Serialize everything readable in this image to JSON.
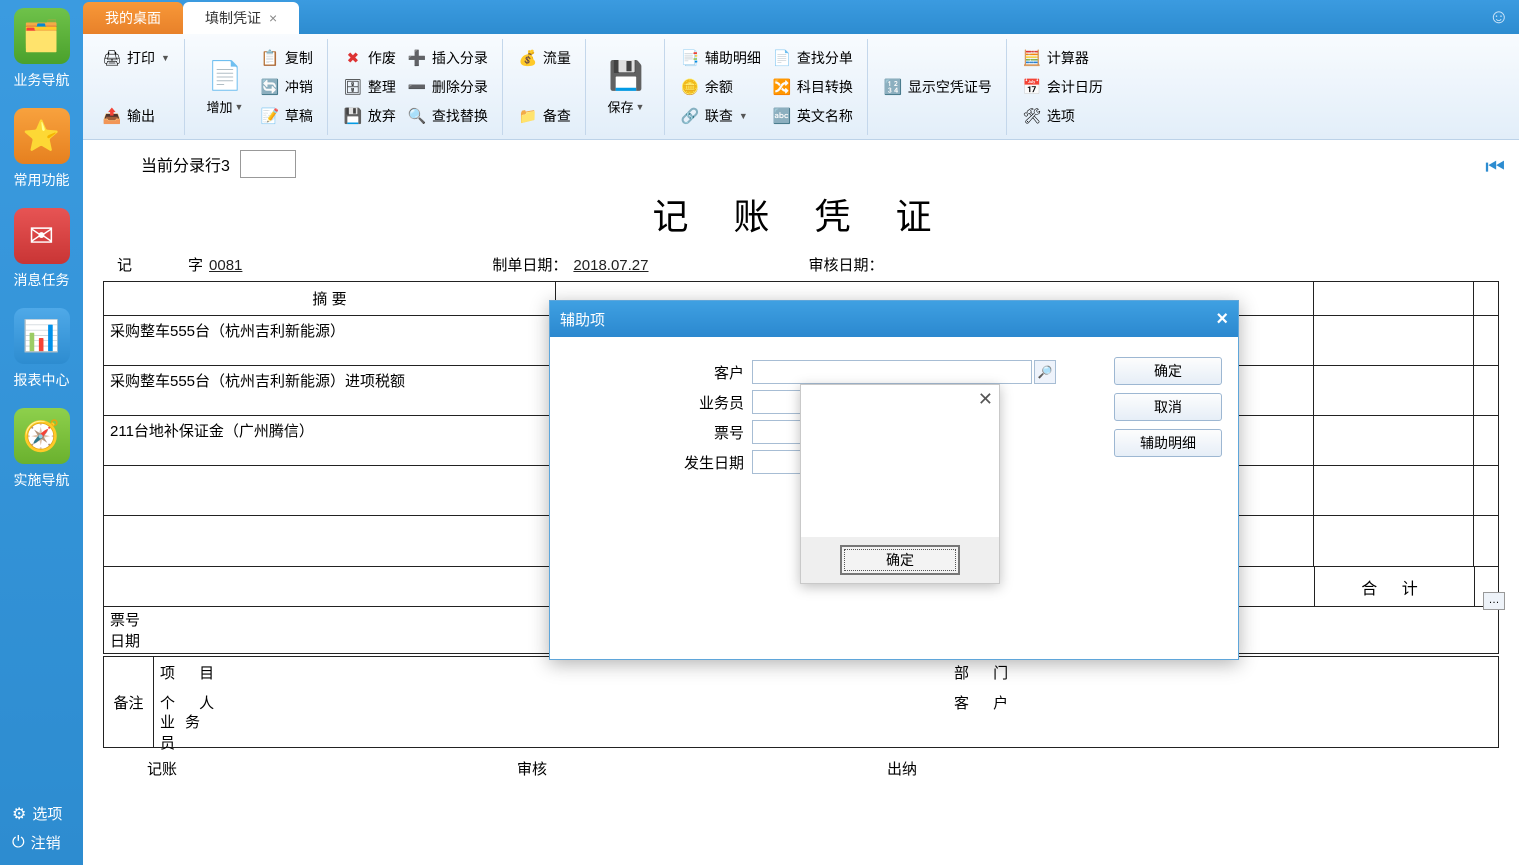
{
  "sidebar": {
    "items": [
      {
        "label": "业务导航"
      },
      {
        "label": "常用功能"
      },
      {
        "label": "消息任务"
      },
      {
        "label": "报表中心"
      },
      {
        "label": "实施导航"
      }
    ],
    "bottom": [
      {
        "label": "选项"
      },
      {
        "label": "注销"
      }
    ]
  },
  "tabs": {
    "desktop": "我的桌面",
    "voucher": "填制凭证"
  },
  "ribbon": {
    "print": "打印",
    "export": "输出",
    "add": "增加",
    "copy": "复制",
    "hedge": "冲销",
    "draft": "草稿",
    "void": "作废",
    "tidy": "整理",
    "abandon": "放弃",
    "insertEntry": "插入分录",
    "delEntry": "删除分录",
    "findReplace": "查找替换",
    "flow": "流量",
    "recheck": "备查",
    "save": "保存",
    "auxDetail": "辅助明细",
    "balance": "余额",
    "linked": "联查",
    "findSingle": "查找分单",
    "subjectSwitch": "科目转换",
    "english": "英文名称",
    "showEmpty": "显示空凭证号",
    "calculator": "计算器",
    "calendar": "会计日历",
    "options": "选项"
  },
  "content": {
    "curEntryLabel": "当前分录行3",
    "title": "记 账 凭 证",
    "recLabel": "记",
    "ziLabel": "字",
    "number": "0081",
    "makeDateLabel": "制单日期：",
    "makeDate": "2018.07.27",
    "auditDateLabel": "审核日期：",
    "tableHead": {
      "summary": "摘 要",
      "total": "合 计"
    },
    "rows": [
      "采购整车555台（杭州吉利新能源）",
      "采购整车555台（杭州吉利新能源）进项税额",
      "211台地补保证金（广州腾信）",
      "",
      ""
    ],
    "footer1": {
      "ticket": "票号",
      "date": "日期"
    },
    "footer2": {
      "remark": "备注",
      "rows": [
        {
          "l": "项 目",
          "r": "部 门"
        },
        {
          "l": "个 人",
          "r": "客 户"
        },
        {
          "l": "业务员",
          "r": ""
        }
      ]
    },
    "sign": {
      "a": "记账",
      "b": "审核",
      "c": "出纳"
    }
  },
  "dialog": {
    "title": "辅助项",
    "fields": {
      "customer": "客户",
      "salesperson": "业务员",
      "ticket": "票号",
      "occurDate": "发生日期"
    },
    "btns": {
      "ok": "确定",
      "cancel": "取消",
      "auxDetail": "辅助明细"
    }
  },
  "popup": {
    "ok": "确定"
  }
}
